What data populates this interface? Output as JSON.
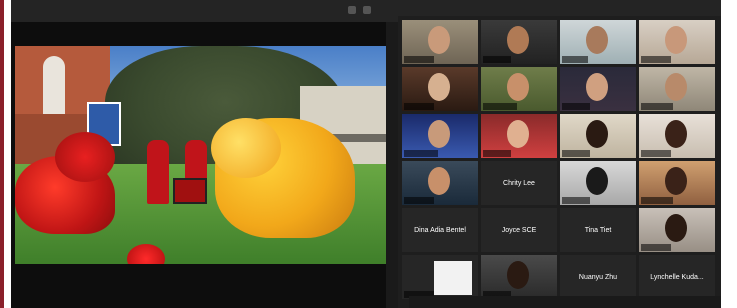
{
  "app": {
    "accent_color": "#e8d94a",
    "border_color": "#8a1f2a"
  },
  "gallery": {
    "name_tiles": [
      {
        "id": "chrity",
        "label": "Chrity Lee"
      },
      {
        "id": "dina",
        "label": "Dina Adia Bentel"
      },
      {
        "id": "joyce",
        "label": "Joyce SCE"
      },
      {
        "id": "tina",
        "label": "Tina Tiet"
      },
      {
        "id": "nuanyu",
        "label": "Nuanyu Zhu"
      },
      {
        "id": "lynchelle",
        "label": "Lynchelle Kuda..."
      }
    ]
  }
}
